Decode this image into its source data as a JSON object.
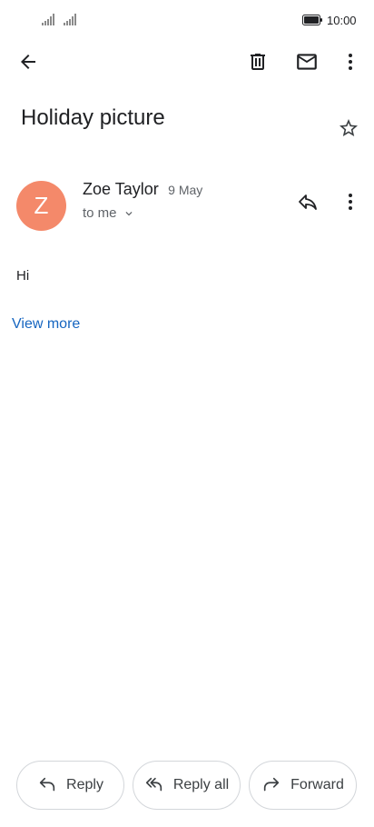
{
  "status_bar": {
    "time": "10:00"
  },
  "email": {
    "subject": "Holiday picture",
    "sender": {
      "initial": "Z",
      "name": "Zoe Taylor",
      "date": "9 May",
      "avatar_color": "#f4896a"
    },
    "recipient": "to me",
    "body": "Hi",
    "view_more": "View more"
  },
  "toolbar_icons": [
    "arrow-back-icon",
    "delete-icon",
    "mail-icon",
    "more-vert-icon"
  ],
  "actions": {
    "reply": "Reply",
    "reply_all": "Reply all",
    "forward": "Forward"
  }
}
